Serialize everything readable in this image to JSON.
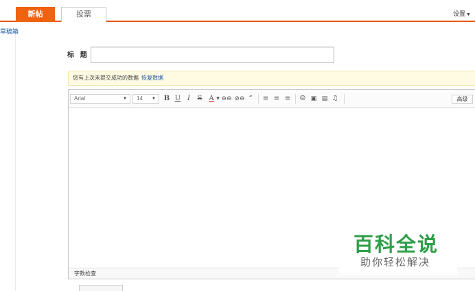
{
  "tabs": [
    {
      "label": "新帖",
      "active": true
    },
    {
      "label": "投票",
      "active": false
    }
  ],
  "settings_label": "设置",
  "drafts_link": "草稿箱",
  "title_field": {
    "label": "标 题",
    "value": ""
  },
  "notice": {
    "text": "您有上次未提交成功的数据",
    "link": "恢复数据"
  },
  "toolbar": {
    "font": "Arial",
    "size": "14",
    "advanced_label": "高级"
  },
  "statusbar": {
    "word_check": "字数检查"
  },
  "watermark": {
    "main": "百科全说",
    "sub": "助你轻松解决"
  },
  "colors": {
    "accent": "#f0620f",
    "link": "#1f5aa8",
    "watermark": "#2e9e48"
  }
}
